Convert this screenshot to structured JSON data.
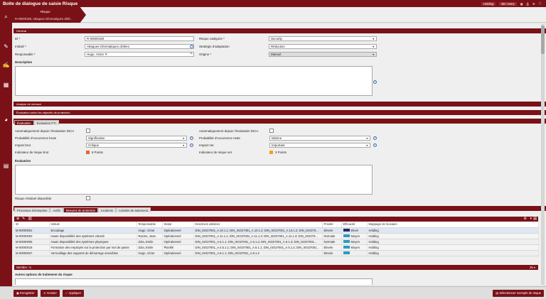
{
  "app": {
    "title": "Boîte de dialogue de saisie Risque"
  },
  "topbar": {
    "module": "Holding",
    "user": "BIC Harry"
  },
  "tab": {
    "label": "Risque",
    "subtitle": "R-00000180, Attaques informatiques ciblé..."
  },
  "sections": {
    "general": "Général",
    "analysis": "Analyse de menace",
    "evaluation_goals": "Évaluation selon les objectifs de protection",
    "description_label": "Description",
    "evaluation_label": "Évaluation"
  },
  "general": {
    "id_label": "ID *",
    "id_value": "R-00000180",
    "title_label": "Intitulé *",
    "title_value": "Attaques informatiques ciblées",
    "owner_label": "Responsable *",
    "owner_value": "Hugo, Victor",
    "category_label": "Risque catégorie *",
    "category_value": "Security",
    "strategy_label": "Stratégie d'adaptation",
    "strategy_value": "Réduction",
    "origin_label": "Origine *",
    "origin_value": "Manuel"
  },
  "evaluation": {
    "tabs": [
      "Évaluation",
      "Évaluation PTI"
    ],
    "auto_dica_label": "Automatiquement depuis l'évaluation DICA",
    "gross_prob_label": "Probabilité d'occurrence brute",
    "gross_prob_value": "Significative",
    "gross_impact_label": "Impact brut",
    "gross_impact_value": "Critique",
    "gross_indicator_label": "Indicateur de risque brut",
    "gross_indicator_value": "8 Points",
    "auto_dica_net_label": "Automatiquement depuis l'évaluation DICA",
    "net_prob_label": "Probabilité d'occurrence nette",
    "net_prob_value": "Minime",
    "net_impact_label": "Impact net",
    "net_impact_value": "Important",
    "net_indicator_label": "Indicateur de risque net",
    "net_indicator_value": "3 Points",
    "residual_label": "Risque résiduel disponible",
    "colors": {
      "gross": "#e8672a",
      "net": "#f0a21d"
    }
  },
  "lower_tabs": [
    "Processus d'entreprise",
    "Actifs",
    "Mesures de protection",
    "Incidents",
    "Activités de traitement"
  ],
  "measures": {
    "columns": [
      "ID",
      "Intitulé",
      "Responsable",
      "Statut",
      "Directives utilisées",
      "Priorité",
      "Efficacité",
      "Mappage de locataire"
    ],
    "rows": [
      {
        "id": "M-00000001",
        "title": "Encodage",
        "owner": "Hugo, Victor",
        "status": "Opérationnel",
        "directives": "DIN_ISO27001_A.10.1.1; DIN_ISO27001_A.10.1.2; DIN_ISO27001_A.10.1.2; DIN_ISO270...",
        "priority": "Elevée",
        "efficacy": "Elevé",
        "tenant": "Holding",
        "color": "#1f2c6b"
      },
      {
        "id": "M-00000003",
        "title": "Haute disponibilité des systèmes virtuels",
        "owner": "Racine, Jean",
        "status": "Opérationnel",
        "directives": "DIN_ISO27001_A.11.1.1; DIN_ISO27001_A.11.1.2; DIN_ISO27001_A.11.1.3; DIN_ISO270...",
        "priority": "Normale",
        "efficacy": "Moyen",
        "tenant": "Holding",
        "color": "#2a9bbf"
      },
      {
        "id": "M-00000005",
        "title": "Haute disponibilité des systèmes physiques",
        "owner": "Zola, Emile",
        "status": "Opérationnel",
        "directives": "DIN_ISO27001_A.6.1.1; DIN_ISO27001_A.6.1.2; DIN_ISO27001_A.6.1.3; DIN_ISO27001...",
        "priority": "Normale",
        "efficacy": "Moyen",
        "tenant": "Holding",
        "color": "#2a9bbf"
      },
      {
        "id": "M-00000018",
        "title": "Formation des employés sur la protection par mot de passe",
        "owner": "Zola, Emile",
        "status": "Planifié",
        "directives": "DIN_ISO27001_A.4.5.1.1; DIN_ISO27001_A.5.1.1; DIN_ISO27001_A.5.1.2; DIN_ISO27001...",
        "priority": "Elevée",
        "efficacy": "Moyen",
        "tenant": "Holding",
        "color": "#2a9bbf"
      },
      {
        "id": "M-00000027",
        "title": "Verrouillage des supports de démarrage amovibles",
        "owner": "Hugo, Victor",
        "status": "Opérationnel",
        "directives": "DIN_ISO27001_A.8.1.1; DIN_ISO27001_A.8.1.2",
        "priority": "Elevée",
        "efficacy": "",
        "tenant": "Holding",
        "color": "#2a9bbf"
      }
    ],
    "footer": "Nombre : 6",
    "other_options_label": "Autres options de traitement du risque"
  },
  "buttons": {
    "save": "Enregistrer",
    "cancel": "Annuler",
    "apply": "Appliquer",
    "template": "Sélectionner exemple de risque"
  }
}
